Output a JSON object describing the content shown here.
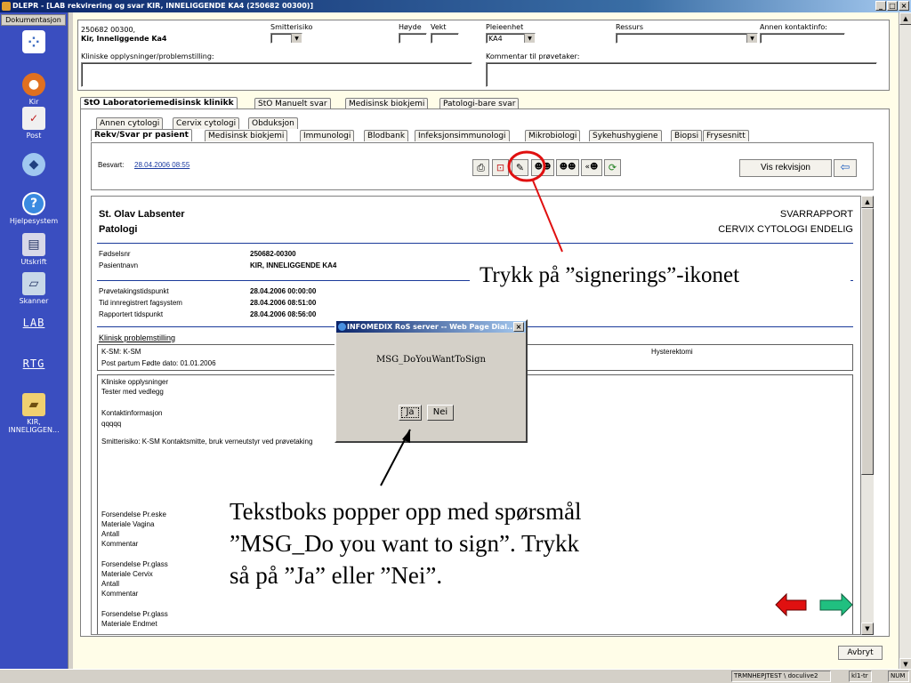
{
  "window": {
    "title": "DLEPR - [LAB rekvirering og svar  KIR, INNELIGGENDE KA4 (250682 00300)]",
    "min": "_",
    "max": "□",
    "close": "×"
  },
  "sidebar": {
    "tab": "Dokumentasjon",
    "items": {
      "kir": "Kir",
      "post": "Post",
      "help": "Hjelpesystem",
      "print": "Utskrift",
      "scan": "Skanner",
      "lab": "LAB",
      "rtg": "RTG",
      "patient1": "KIR,",
      "patient2": "INNELIGGEN..."
    }
  },
  "patient": {
    "id": "250682 00300,",
    "name": "Kir, Inneliggende Ka4"
  },
  "fields": {
    "smitte_label": "Smitterisiko",
    "hoyde_label": "Høyde",
    "vekt_label": "Vekt",
    "pleie_label": "Pleieenhet",
    "pleie_value": "KA4",
    "ressurs_label": "Ressurs",
    "annen_label": "Annen kontaktinfo:",
    "klinisk_label": "Kliniske opplysninger/problemstilling:",
    "kommentar_label": "Kommentar til prøvetaker:"
  },
  "tabs_row1": [
    "StO Laboratoriemedisinsk klinikk",
    "StO Manuelt svar",
    "Medisinsk biokjemi",
    "Patologi-bare svar"
  ],
  "tabs_row2": [
    "Annen cytologi",
    "Cervix cytologi",
    "Obduksjon"
  ],
  "tabs_row3": [
    "Rekv/Svar pr pasient",
    "Medisinsk biokjemi",
    "Immunologi",
    "Blodbank",
    "Infeksjonsimmunologi",
    "Mikrobiologi",
    "Sykehushygiene",
    "Biopsi",
    "Frysesnitt"
  ],
  "besvart": {
    "label": "Besvart:",
    "date": "28.04.2006 08:55"
  },
  "vis_rekvisjon": "Vis rekvisjon",
  "report": {
    "lab1": "St. Olav Labsenter",
    "lab2": "Patologi",
    "title1": "SVARRAPPORT",
    "title2": "CERVIX CYTOLOGI ENDELIG",
    "fodselsnr_label": "Fødselsnr",
    "fodselsnr": "250682-00300",
    "pasientnavn_label": "Pasientnavn",
    "pasientnavn": "KIR, INNELIGGENDE KA4",
    "prove_label": "Prøvetakingstidspunkt",
    "prove": "28.04.2006 00:00:00",
    "innreg_label": "Tid innregistrert fagsystem",
    "innreg": "28.04.2006 08:51:00",
    "rapp_label": "Rapportert tidspunkt",
    "rapp": "28.04.2006 08:56:00",
    "klinisk_heading": "Klinisk problemstilling",
    "ksm": "K-SM: K-SM",
    "postpartum": "Post partum Fødte dato: 01.01.2006",
    "hysterektomi": "Hysterektomi",
    "klin_opp": "Kliniske opplysninger",
    "tester": "Tester med vedlegg",
    "kontakt": "Kontaktinformasjon",
    "qqqqq": "qqqqq",
    "smitte": "Smitterisiko: K-SM Kontaktsmitte, bruk verneutstyr ved prøvetaking",
    "f1a": "Forsendelse Pr.eske",
    "f1b": "Materiale Vagina",
    "f1c": "Antall",
    "f1d": "Kommentar",
    "f2a": "Forsendelse Pr.glass",
    "f2b": "Materiale Cervix",
    "f2c": "Antall",
    "f2d": "Kommentar",
    "f3a": "Forsendelse Pr.glass",
    "f3b": "Materiale Endmet"
  },
  "dialog": {
    "title": "INFOMEDIX RoS server -- Web Page Dial...",
    "message": "MSG_DoYouWantToSign",
    "yes": "Ja",
    "no": "Nei"
  },
  "callouts": {
    "top": "Trykk på ”signerings”-ikonet",
    "bottom1": "Tekstboks popper opp med spørsmål",
    "bottom2": "”MSG_Do you want to sign”. Trykk",
    "bottom3": "så på ”Ja” eller ”Nei”."
  },
  "avbryt": "Avbryt",
  "status": {
    "s1": "TRMNHEPJTEST \\ doculive2",
    "s2": "kl1-tr",
    "s3": "NUM"
  },
  "colors": {
    "accent_red": "#e01010",
    "arrow_green": "#20c080",
    "sidebar_blue": "#3a4ec0",
    "report_line": "#1a3a9a"
  }
}
